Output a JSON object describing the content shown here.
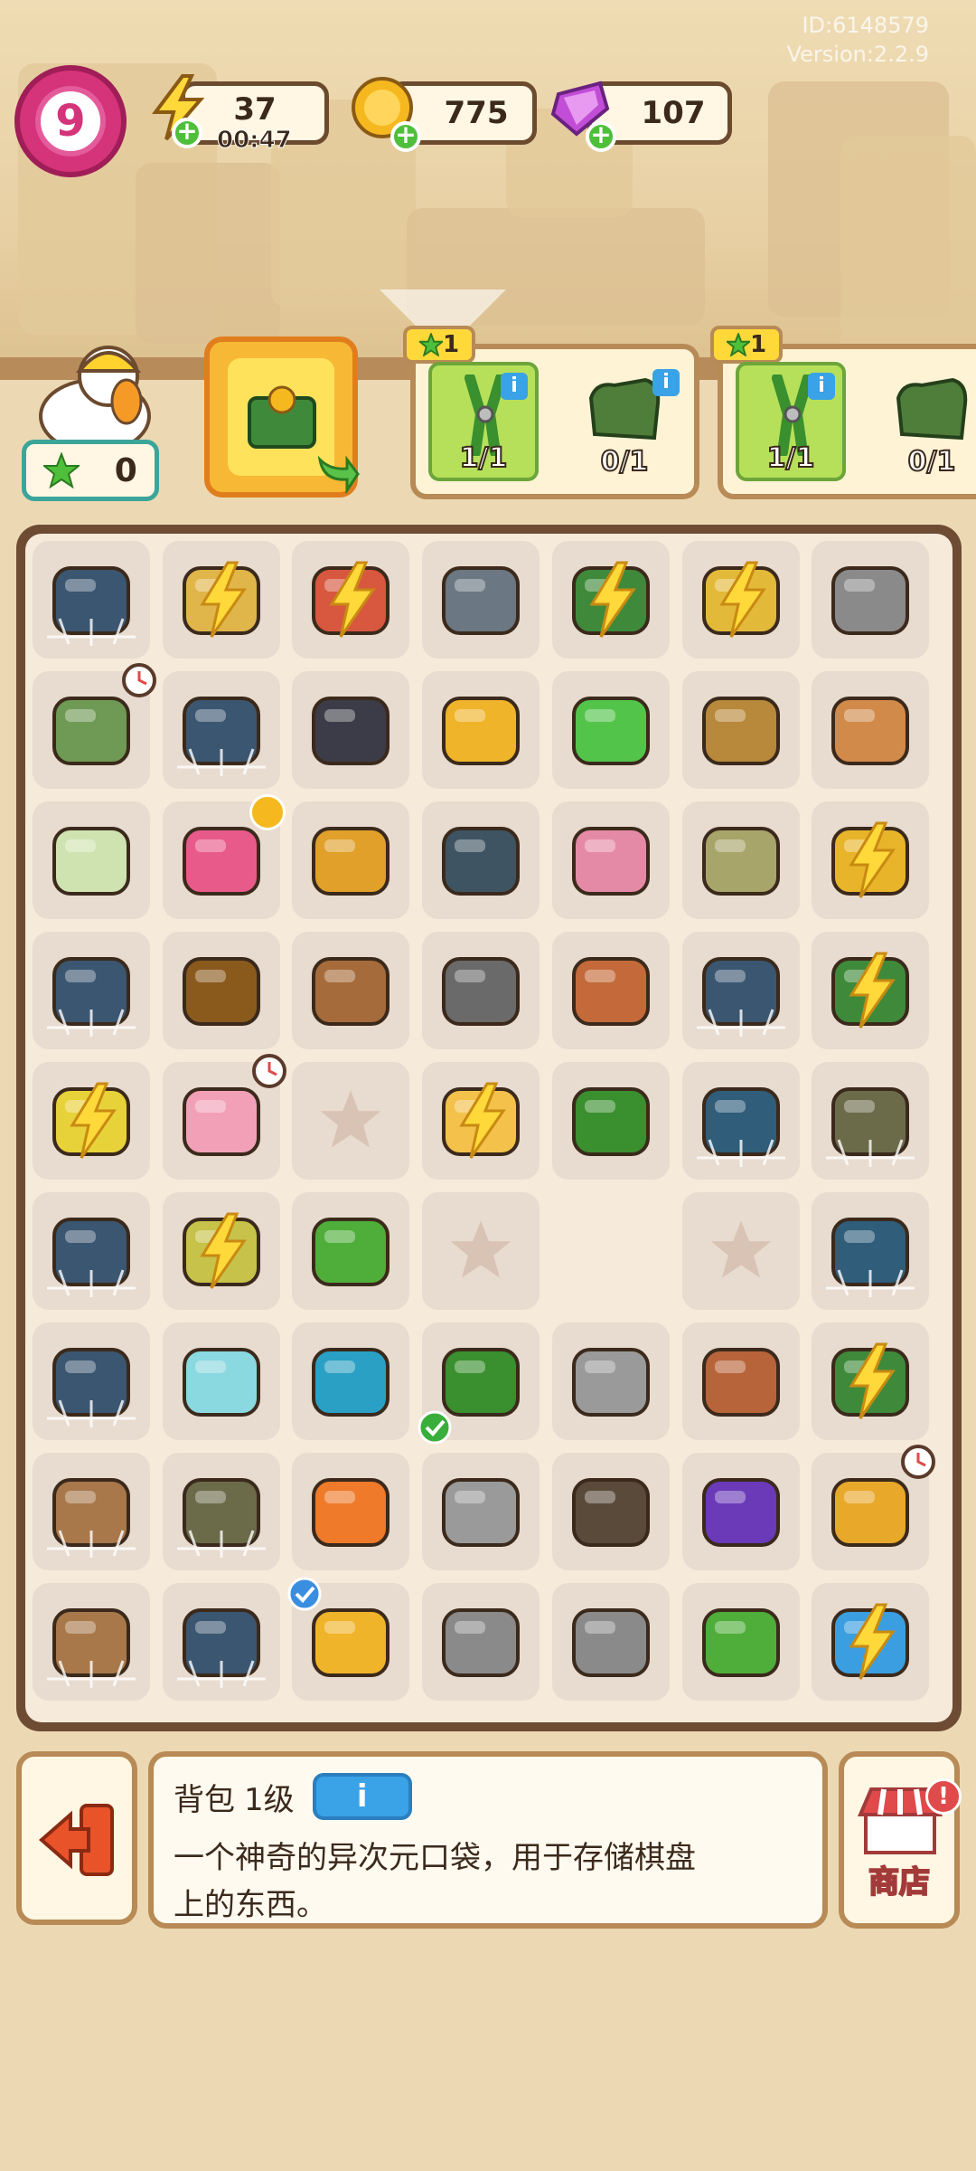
{
  "version_info": {
    "id": "ID:6148579",
    "version": "Version:2.2.9"
  },
  "player": {
    "level": "9"
  },
  "resources": {
    "energy": {
      "value": "37",
      "timer": "00:47"
    },
    "coins": {
      "value": "775"
    },
    "gems": {
      "value": "107"
    }
  },
  "character": {
    "star_count": "0"
  },
  "orders": [
    {
      "reward": "1",
      "slots": [
        {
          "icon": "pliers",
          "count": "1/1",
          "done": true
        },
        {
          "icon": "work-gloves",
          "count": "0/1",
          "done": false
        }
      ]
    },
    {
      "reward": "1",
      "slots": [
        {
          "icon": "pliers",
          "count": "1/1",
          "done": true
        },
        {
          "icon": "work-gloves",
          "count": "0/1",
          "done": false
        }
      ]
    }
  ],
  "board": {
    "rows": [
      [
        "cpu-chip-cobweb",
        "paper-bin-energy",
        "toolbox-energy",
        "snail-shell",
        "money-box-energy",
        "shopping-cart-energy",
        "shopping-cart"
      ],
      [
        "radio-timer",
        "cpu-chip-cobweb",
        "black-glove",
        "coin-stack",
        "green-chip",
        "wicker-basket",
        "stone"
      ],
      [
        "map-paper",
        "pink-backpack",
        "wood-planks",
        "black-hose",
        "pink-brick",
        "sand-bag",
        "yellow-box-energy"
      ],
      [
        "cpu-chip-cobweb",
        "coiled-rope",
        "plant-pot",
        "caster-wheel",
        "stopwatch",
        "cpu-chip-cobweb",
        "money-box-energy"
      ],
      [
        "cart-energy",
        "pink-bag-timer",
        "empty",
        "hat-energy",
        "screwdriver",
        "circuit-board-cobweb",
        "boat-cobweb"
      ],
      [
        "cpu-chip-cobweb",
        "sack-energy",
        "green-pipe",
        "empty",
        "empty-plain",
        "empty",
        "circuit-board-cobweb"
      ],
      [
        "cpu-chip-cobweb",
        "dumbbell",
        "blue-ring",
        "pliers",
        "wrench",
        "wallet",
        "green-chest-energy"
      ],
      [
        "cardboard-box",
        "boat-cobweb",
        "orange-toolbox",
        "wrench",
        "double-wheel",
        "purple-goggles",
        "cabinet-timer"
      ],
      [
        "cardboard-box",
        "cpu-chip-cobweb",
        "yellow-drawer",
        "pipe-wrench",
        "pipe-wrench",
        "hacksaw",
        "blue-robot-energy"
      ]
    ]
  },
  "description": {
    "title": "背包",
    "level": "1级",
    "info_label": "i",
    "text_line1": "一个神奇的异次元口袋，用于存储棋盘",
    "text_line2": "上的东西。"
  },
  "shop": {
    "label": "商店",
    "alert": "!"
  },
  "colors": {
    "background": "#ecd9b4",
    "board_frame": "#6e4c33",
    "cell": "#e8dbcf",
    "energy_yellow": "#ffd83a",
    "accent_blue": "#3aa2e6"
  }
}
